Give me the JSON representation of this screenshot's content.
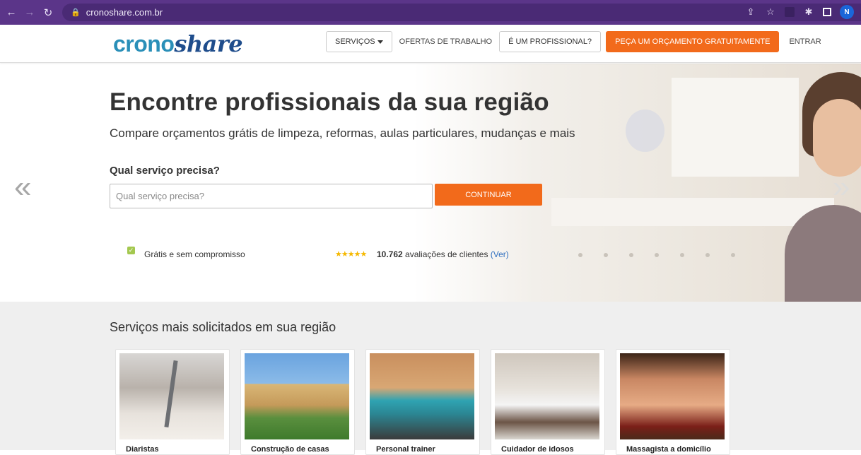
{
  "browser": {
    "url": "cronoshare.com.br",
    "profile_initial": "N"
  },
  "header": {
    "logo_part1": "crono",
    "logo_part2": "share",
    "nav": {
      "servicos": "SERVIÇOS",
      "ofertas": "OFERTAS DE TRABALHO",
      "profissional": "É UM PROFISSIONAL?",
      "orcamento": "PEÇA UM ORÇAMENTO GRATUITAMENTE",
      "entrar": "ENTRAR"
    }
  },
  "hero": {
    "title": "Encontre profissionais da sua região",
    "subtitle": "Compare orçamentos grátis de limpeza, reformas, aulas particulares, mudanças e mais",
    "question_label": "Qual serviço precisa?",
    "search_placeholder": "Qual serviço precisa?",
    "continue_label": "CONTINUAR",
    "prev_arrow": "«",
    "next_arrow": "»",
    "free_text": "Grátis e sem compromisso",
    "stars": "★★★★★",
    "review_count": "10.762",
    "review_text": "avaliações de clientes",
    "review_link": "(Ver)"
  },
  "services": {
    "title": "Serviços mais solicitados em sua região",
    "cards": [
      {
        "label": "Diaristas"
      },
      {
        "label": "Construção de casas"
      },
      {
        "label": "Personal trainer"
      },
      {
        "label": "Cuidador de idosos"
      },
      {
        "label": "Massagista a domicílio"
      }
    ]
  },
  "colors": {
    "brand_orange": "#f26a1b",
    "brand_blue": "#2a8fb8",
    "chrome_purple": "#5b3589"
  }
}
